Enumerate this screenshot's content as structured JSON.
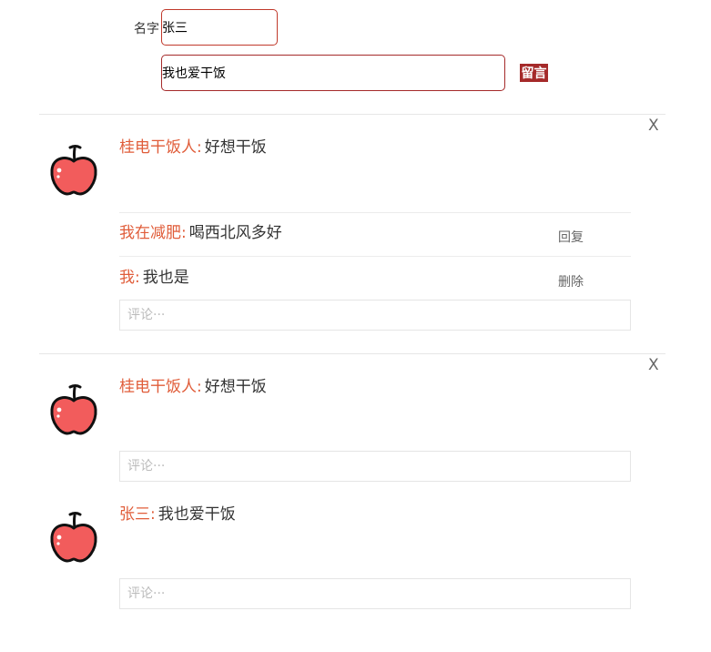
{
  "form": {
    "name_label": "名字",
    "name_value": "张三",
    "message_value": "我也爱干饭",
    "submit_label": "留言"
  },
  "threads": [
    {
      "close_label": "X",
      "post": {
        "author": "桂电干饭人",
        "colon": ":",
        "text": "好想干饭"
      },
      "replies": [
        {
          "author": "我在减肥",
          "colon": ":",
          "text": "喝西北风多好",
          "action": "回复"
        },
        {
          "author": "我",
          "colon": ":",
          "text": "我也是",
          "action": "删除"
        }
      ],
      "comment_placeholder": "评论···"
    },
    {
      "close_label": "X",
      "post": {
        "author": "桂电干饭人",
        "colon": ":",
        "text": "好想干饭"
      },
      "replies": [],
      "comment_placeholder": "评论···"
    },
    {
      "post": {
        "author": "张三",
        "colon": ":",
        "text": "我也爱干饭"
      },
      "replies": [],
      "comment_placeholder": "评论···"
    }
  ],
  "colors": {
    "accent": "#a52a2a",
    "author": "#e05d3a",
    "apple": "#f25c5c"
  },
  "icons": {
    "avatar": "apple-icon",
    "close": "close-icon"
  }
}
